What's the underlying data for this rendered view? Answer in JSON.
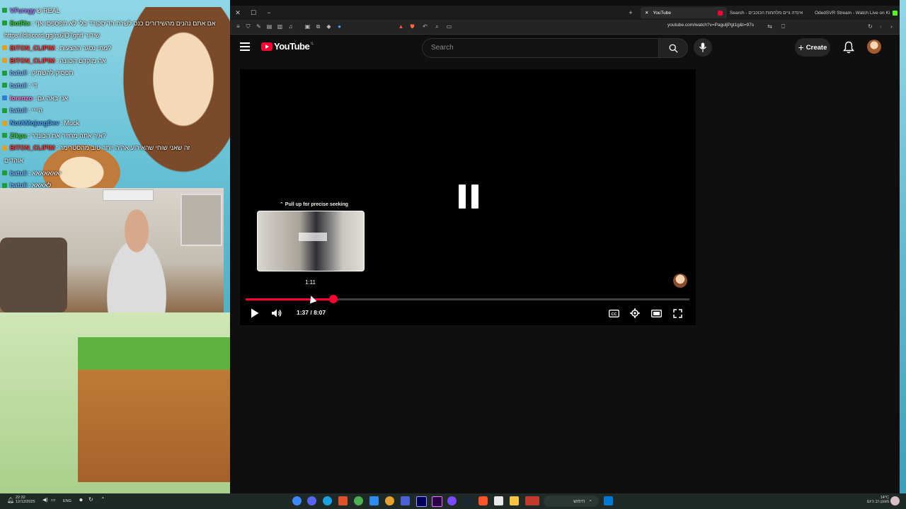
{
  "overlay": {
    "chat": [
      {
        "name": "VFuregy",
        "color": "#b07cff",
        "msg": "ש REAL",
        "badge": "b1"
      },
      {
        "name": "BotRix",
        "color": "#3ad13a",
        "msg": ": אם אתם נהנים מהשידורים כנס לשרת הדיסקורד בלי לא תפספסו אף",
        "badge": "b1"
      },
      {
        "name": "",
        "color": "#ffffff",
        "msg": "https://discord.gg/rs6lD7ghfl שידור",
        "badge": ""
      },
      {
        "name": "BITON_CLIPIM",
        "color": "#ff3b3b",
        "msg": ": מתי נסגר ההצעות?",
        "badge": "b3"
      },
      {
        "name": "BITON_CLIPIM",
        "color": "#ff3b3b",
        "msg": ": אה מוקדם הכוונה",
        "badge": "b3"
      },
      {
        "name": "batuli",
        "color": "#7ab8ff",
        "msg": ": תפסיק להשתיק",
        "badge": "b1"
      },
      {
        "name": "batuli",
        "color": "#7ab8ff",
        "msg": ": די",
        "badge": "b1"
      },
      {
        "name": "lorenzo",
        "color": "#ff7ad9",
        "msg": ": אני באה גם",
        "badge": "b2"
      },
      {
        "name": "batuli",
        "color": "#7ab8ff",
        "msg": ": היייי",
        "badge": "b1"
      },
      {
        "name": "NotAMojangDev",
        "color": "#4aa3ff",
        "msg": ": Muck",
        "badge": "b3"
      },
      {
        "name": "Zikpa",
        "color": "#3ad13a",
        "msg": ": איך אתה מחזיר את הכונדר?",
        "badge": "b1"
      },
      {
        "name": "BITON_CLIPIM",
        "color": "#ff3b3b",
        "msg": ": זה שאני שוחי שהאירוע אהיה יותר טוב מהסטרימר",
        "badge": "b3"
      },
      {
        "name": "",
        "color": "#ffffff",
        "msg": "אוהדים",
        "badge": ""
      },
      {
        "name": "batuli",
        "color": "#7ab8ff",
        "msg": ": יאאאאאאא",
        "badge": "b1"
      },
      {
        "name": "batuli",
        "color": "#7ab8ff",
        "msg": ": לאאאא",
        "badge": "b1"
      }
    ]
  },
  "browser": {
    "tabs": [
      {
        "label": "YouTube",
        "active": true
      },
      {
        "label": "Search - אינדה גיים מלחמות הכוכבים",
        "active": false
      },
      {
        "label": "OdedSVR Stream - Watch Live on Ki",
        "active": false
      }
    ],
    "url": "youtube.com/watch?v=PaguljPgt1g&t=97s"
  },
  "youtube": {
    "logo_text": "YouTube",
    "logo_country": "IL",
    "search_placeholder": "Search",
    "create_label": "Create"
  },
  "player": {
    "seek_hint": "⌃ Pull up for precise seeking",
    "preview_time": "1:11",
    "current_time": "1:37",
    "duration": "8:07",
    "time_display": "1:37 / 8:07",
    "played_fraction": 0.198,
    "hover_fraction": 0.149,
    "buffer_fraction": 0.2,
    "state": "paused"
  },
  "taskbar": {
    "time": "22:32",
    "date": "12/12/2025",
    "lang": "ENG",
    "search_label": "חיפוש",
    "weather_temp": "14°C",
    "weather_desc": "מעונן רב היום"
  },
  "colors": {
    "accent": "#ff0033",
    "background": "#0f0f0f"
  }
}
